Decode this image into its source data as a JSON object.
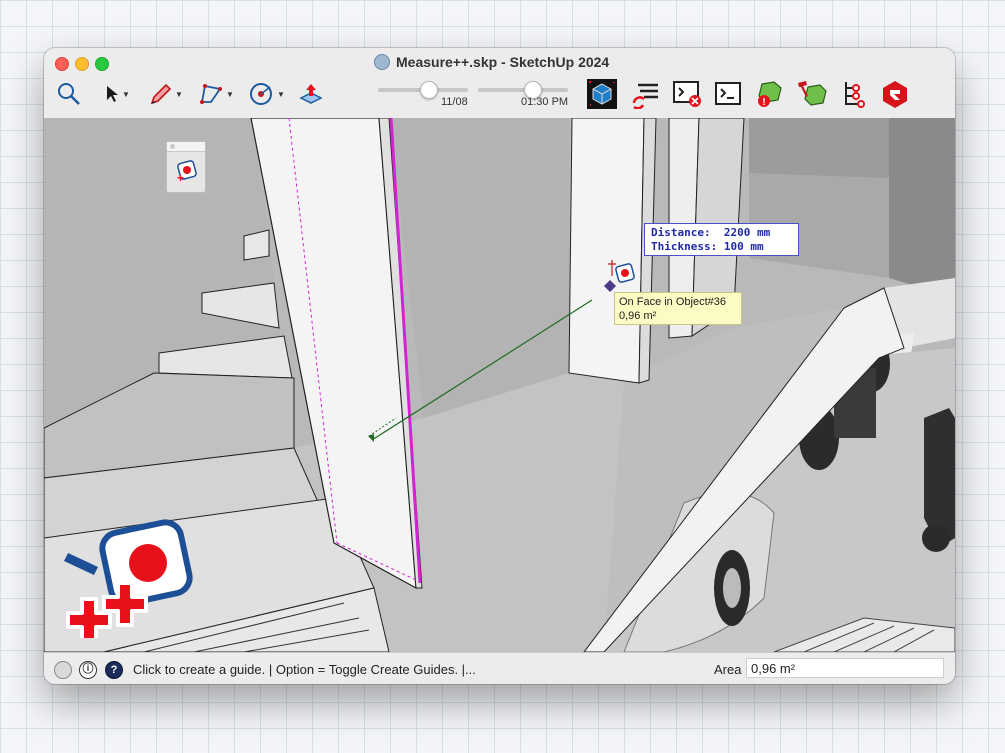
{
  "window": {
    "title": "Measure++.skp - SketchUp 2024"
  },
  "toolbar": {
    "tools": [
      {
        "name": "search",
        "icon": "magnifier-icon"
      },
      {
        "name": "select",
        "icon": "arrow-cursor-icon"
      },
      {
        "name": "pencil",
        "icon": "pencil-icon"
      },
      {
        "name": "arc",
        "icon": "arc-icon"
      },
      {
        "name": "circle",
        "icon": "target-icon"
      },
      {
        "name": "push",
        "icon": "push-pull-icon"
      }
    ],
    "date_slider": {
      "label": "11/08",
      "value": 0.55
    },
    "time_slider": {
      "label": "01:30 PM",
      "value": 0.6
    },
    "extension_icons": [
      "3d-cube-icon",
      "layers-refresh-icon",
      "console-error-icon",
      "terminal-icon",
      "cube-warning-icon",
      "hammer-cube-icon",
      "tree-nodes-icon",
      "ruby-gem-icon"
    ]
  },
  "measurement": {
    "distance_label": "Distance:",
    "distance_value": "2200 mm",
    "thickness_label": "Thickness:",
    "thickness_value": "100 mm"
  },
  "tooltip": {
    "line1": "On Face in Object#36",
    "line2": "0,96 m²"
  },
  "status": {
    "message": "Click to create a guide. | Option = Toggle Create Guides. |...",
    "area_label": "Area",
    "area_value": "0,96 m²"
  },
  "logo": {
    "text": "++"
  },
  "colors": {
    "accent_red": "#e8111b",
    "accent_blue": "#1d4f96",
    "guide_magenta": "#d324d3",
    "guide_green": "#1f6a1f"
  }
}
